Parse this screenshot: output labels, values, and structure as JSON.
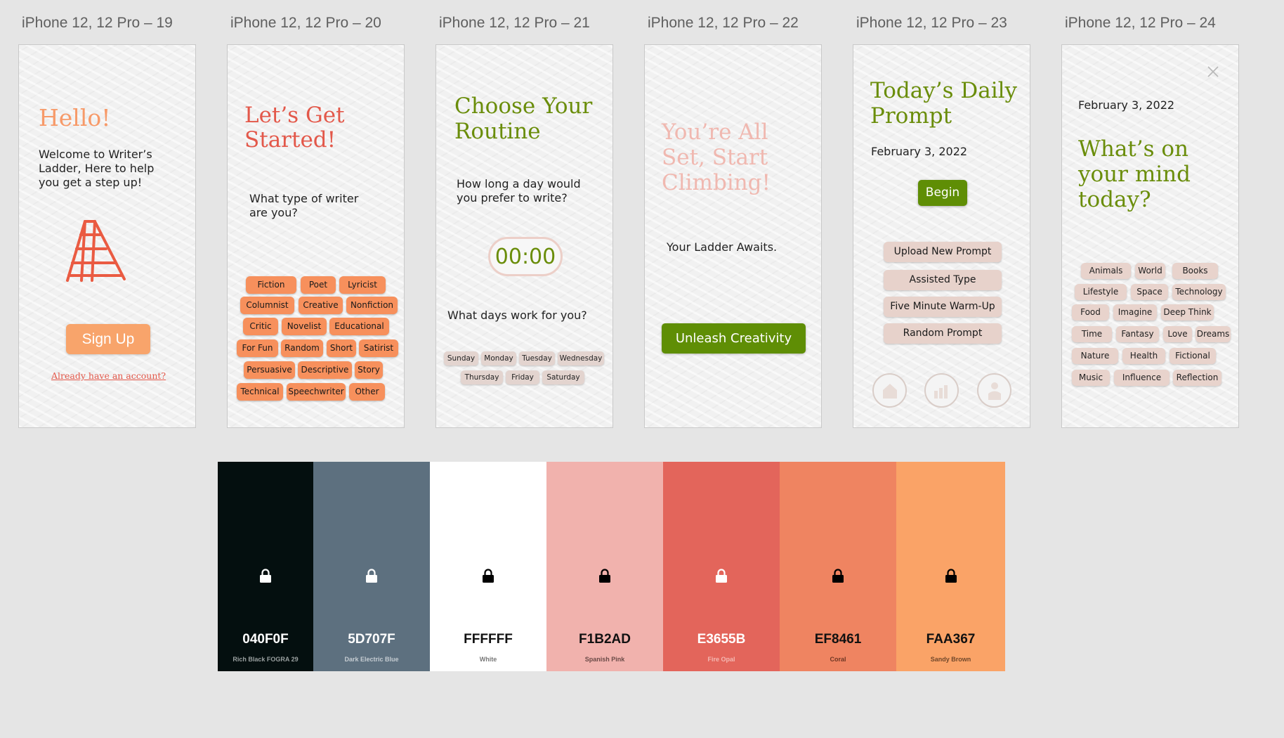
{
  "frames": [
    {
      "label": "iPhone 12, 12 Pro – 19"
    },
    {
      "label": "iPhone 12, 12 Pro – 20"
    },
    {
      "label": "iPhone 12, 12 Pro – 21"
    },
    {
      "label": "iPhone 12, 12 Pro – 22"
    },
    {
      "label": "iPhone 12, 12 Pro – 23"
    },
    {
      "label": "iPhone 12, 12 Pro – 24"
    }
  ],
  "screen19": {
    "title": "Hello!",
    "welcome": [
      "Welcome to Writer’s",
      "Ladder, Here to help",
      "you get a step up!"
    ],
    "signup": "Sign Up",
    "login_link": "Already have an account?"
  },
  "screen20": {
    "title": [
      "Let’s Get",
      "Started!"
    ],
    "question": [
      "What type of writer",
      "are you?"
    ],
    "chips": [
      "Fiction",
      "Poet",
      "Lyricist",
      "Columnist",
      "Creative",
      "Nonfiction",
      "Critic",
      "Novelist",
      "Educational",
      "For Fun",
      "Random",
      "Short",
      "Satirist",
      "Persuasive",
      "Descriptive",
      "Story",
      "Technical",
      "Speechwriter",
      "Other"
    ]
  },
  "screen21": {
    "title": [
      "Choose Your",
      "Routine"
    ],
    "question": [
      "How long a day would",
      "you prefer to write?"
    ],
    "timer": "00:00",
    "days_question": "What days work for you?",
    "days": [
      "Sunday",
      "Monday",
      "Tuesday",
      "Wednesday",
      "Thursday",
      "Friday",
      "Saturday"
    ]
  },
  "screen22": {
    "title": [
      "You’re All",
      "Set, Start",
      "Climbing!"
    ],
    "subtitle": "Your Ladder Awaits.",
    "cta": "Unleash Creativity"
  },
  "screen23": {
    "title": [
      "Today’s Daily",
      "Prompt"
    ],
    "date": "February 3, 2022",
    "begin": "Begin",
    "options": [
      "Upload New Prompt",
      "Assisted Type",
      "Five Minute Warm-Up",
      "Random Prompt"
    ]
  },
  "screen24": {
    "date": "February 3, 2022",
    "title": [
      "What’s on",
      "your mind",
      "today?"
    ],
    "chips": [
      "Animals",
      "World",
      "Books",
      "Lifestyle",
      "Space",
      "Technology",
      "Food",
      "Imagine",
      "Deep Think",
      "Time",
      "Fantasy",
      "Love",
      "Dreams",
      "Nature",
      "Health",
      "Fictional",
      "Music",
      "Influence",
      "Reflection"
    ]
  },
  "palette": [
    {
      "hex": "040F0F",
      "name": "Rich Black FOGRA 29",
      "color": "#040F0F"
    },
    {
      "hex": "5D707F",
      "name": "Dark Electric Blue",
      "color": "#5D707F"
    },
    {
      "hex": "FFFFFF",
      "name": "White",
      "color": "#FFFFFF"
    },
    {
      "hex": "F1B2AD",
      "name": "Spanish Pink",
      "color": "#F1B2AD"
    },
    {
      "hex": "E3655B",
      "name": "Fire Opal",
      "color": "#E3655B"
    },
    {
      "hex": "EF8461",
      "name": "Coral",
      "color": "#EF8461"
    },
    {
      "hex": "FAA367",
      "name": "Sandy Brown",
      "color": "#FAA367"
    }
  ],
  "colors": {
    "title_orange": "#f79a69",
    "title_red": "#e3584a",
    "title_green": "#6a8d0a",
    "button_green": "#5f8e05",
    "chip_orange": "#f7905c",
    "chip_pink": "#e8d3cc"
  }
}
